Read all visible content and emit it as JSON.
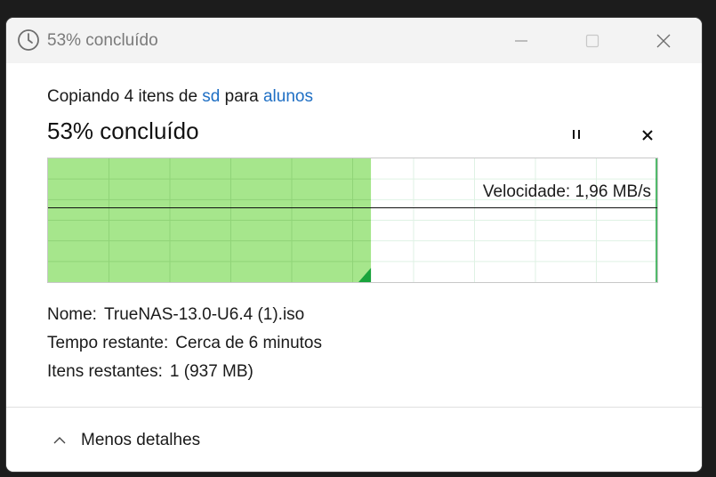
{
  "window": {
    "title": "53% concluído"
  },
  "copy": {
    "prefix": "Copiando 4 itens de",
    "source": "sd",
    "middle": "para",
    "destination": "alunos"
  },
  "progress": {
    "heading": "53% concluído",
    "percent": 53
  },
  "graph": {
    "speed_label": "Velocidade: 1,96 MB/s",
    "fill_color": "#a6e68c",
    "accent_color": "#19a33c"
  },
  "details": {
    "name_label": "Nome:",
    "name_value": "TrueNAS-13.0-U6.4 (1).iso",
    "time_label": "Tempo restante:",
    "time_value": "Cerca de 6 minutos",
    "items_label": "Itens restantes:",
    "items_value": "1 (937 MB)"
  },
  "footer": {
    "less_details": "Menos detalhes"
  },
  "icons": {
    "title": "clock-icon",
    "pause": "pause-icon",
    "cancel": "close-icon",
    "toggle": "chevron-up-icon"
  }
}
